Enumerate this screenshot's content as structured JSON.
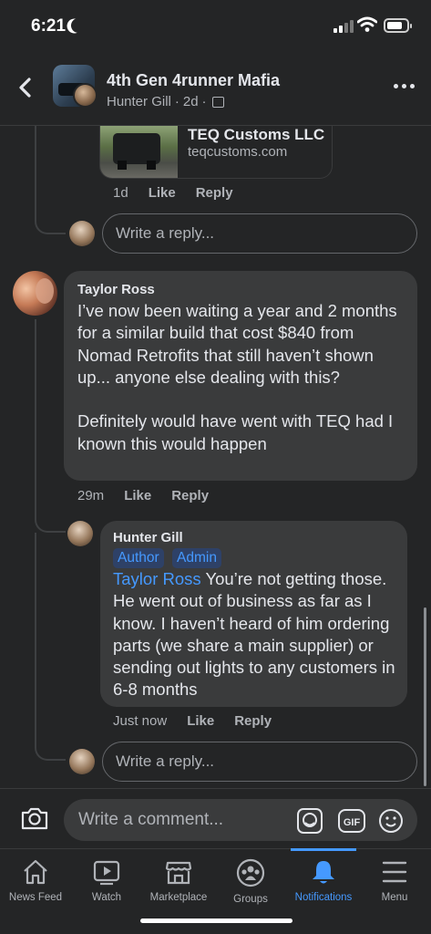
{
  "status_bar": {
    "time": "6:21"
  },
  "header": {
    "title": "4th Gen 4runner Mafia",
    "author": "Hunter Gill",
    "time": "2d",
    "separator": "·"
  },
  "link_preview": {
    "title": "TEQ Customs LLC",
    "domain": "teqcustoms.com"
  },
  "first_meta": {
    "time": "1d",
    "like": "Like",
    "reply": "Reply"
  },
  "reply_placeholder": "Write a reply...",
  "comment_1": {
    "author": "Taylor Ross",
    "text": "I’ve now been waiting a year and 2 months for a similar build that cost $840 from Nomad Retrofits that still haven’t shown up... anyone else dealing with this?\n\nDefinitely would have went with TEQ had I known this would happen",
    "time": "29m",
    "like": "Like",
    "reply": "Reply"
  },
  "comment_2": {
    "author": "Hunter Gill",
    "badge_author": "Author",
    "badge_admin": "Admin",
    "mention": "Taylor Ross",
    "text": " You’re not getting those. He went out of business as far as I know. I haven’t heard of him ordering parts (we share a main supplier) or sending out lights to any customers in 6-8 months",
    "time": "Just now",
    "like": "Like",
    "reply": "Reply"
  },
  "composer": {
    "placeholder": "Write a comment...",
    "gif_label": "GIF"
  },
  "tabs": [
    {
      "label": "News Feed",
      "icon": "home-icon"
    },
    {
      "label": "Watch",
      "icon": "watch-icon"
    },
    {
      "label": "Marketplace",
      "icon": "marketplace-icon"
    },
    {
      "label": "Groups",
      "icon": "groups-icon"
    },
    {
      "label": "Notifications",
      "icon": "bell-icon",
      "active": true
    },
    {
      "label": "Menu",
      "icon": "menu-icon"
    }
  ],
  "colors": {
    "background": "#242526",
    "bubble": "#3a3b3c",
    "accent": "#4599ff",
    "secondary_text": "#b0b3b8"
  }
}
